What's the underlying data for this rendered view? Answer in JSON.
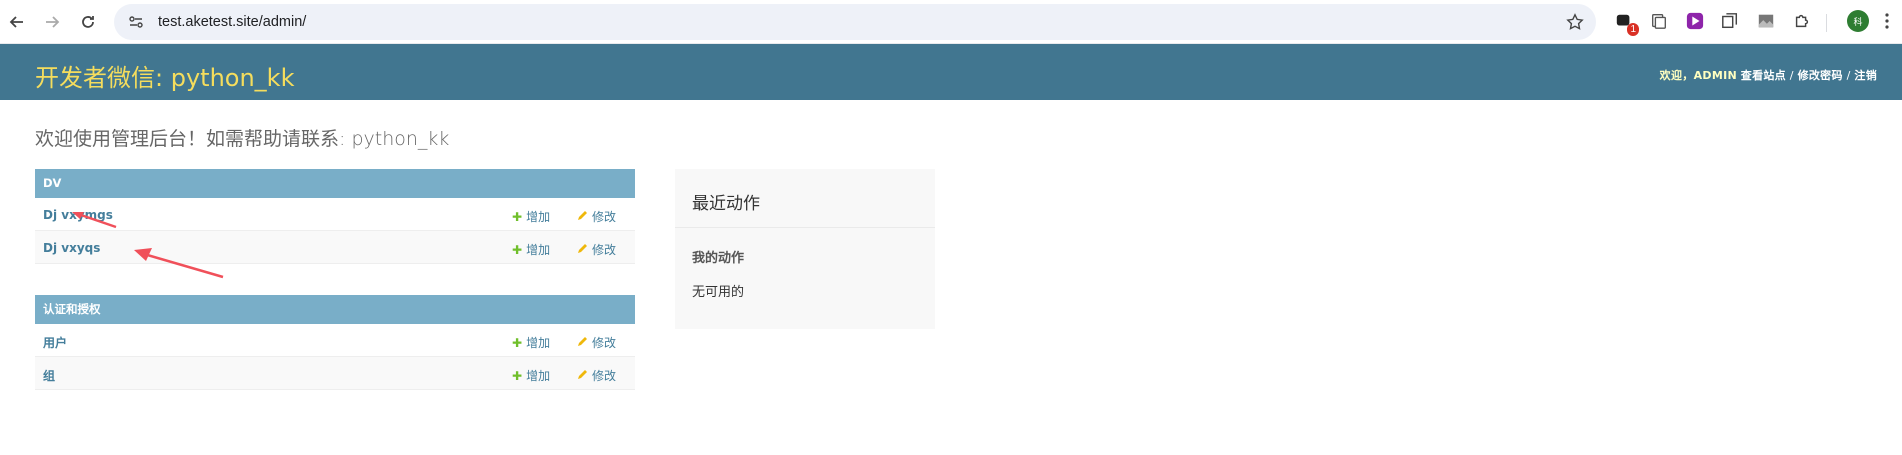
{
  "browser": {
    "url": "test.aketest.site/admin/",
    "ext_badge": "1",
    "profile_initial": "科"
  },
  "header": {
    "brand_main": "开发者微信",
    "brand_suffix": ": python_kk",
    "welcome": "欢迎，",
    "username": "ADMIN",
    "view_site": "查看站点",
    "sep": "/",
    "change_password": "修改密码",
    "logout": "注销"
  },
  "main": {
    "title": "欢迎使用管理后台！如需帮助请联系: python_kk",
    "apps": [
      {
        "name": "DV",
        "models": [
          {
            "name": "Dj vxymgs",
            "add": "增加",
            "change": "修改"
          },
          {
            "name": "Dj vxyqs",
            "add": "增加",
            "change": "修改"
          }
        ]
      },
      {
        "name": "认证和授权",
        "models": [
          {
            "name": "用户",
            "add": "增加",
            "change": "修改"
          },
          {
            "name": "组",
            "add": "增加",
            "change": "修改"
          }
        ]
      }
    ]
  },
  "recent": {
    "title": "最近动作",
    "subtitle": "我的动作",
    "empty": "无可用的"
  },
  "colors": {
    "header_bg": "#417690",
    "brand": "#f5dd5d",
    "caption_bg": "#79aec8",
    "link": "#447e9b",
    "add_icon": "#70bf2b",
    "annotation_arrow": "#f0505a"
  }
}
